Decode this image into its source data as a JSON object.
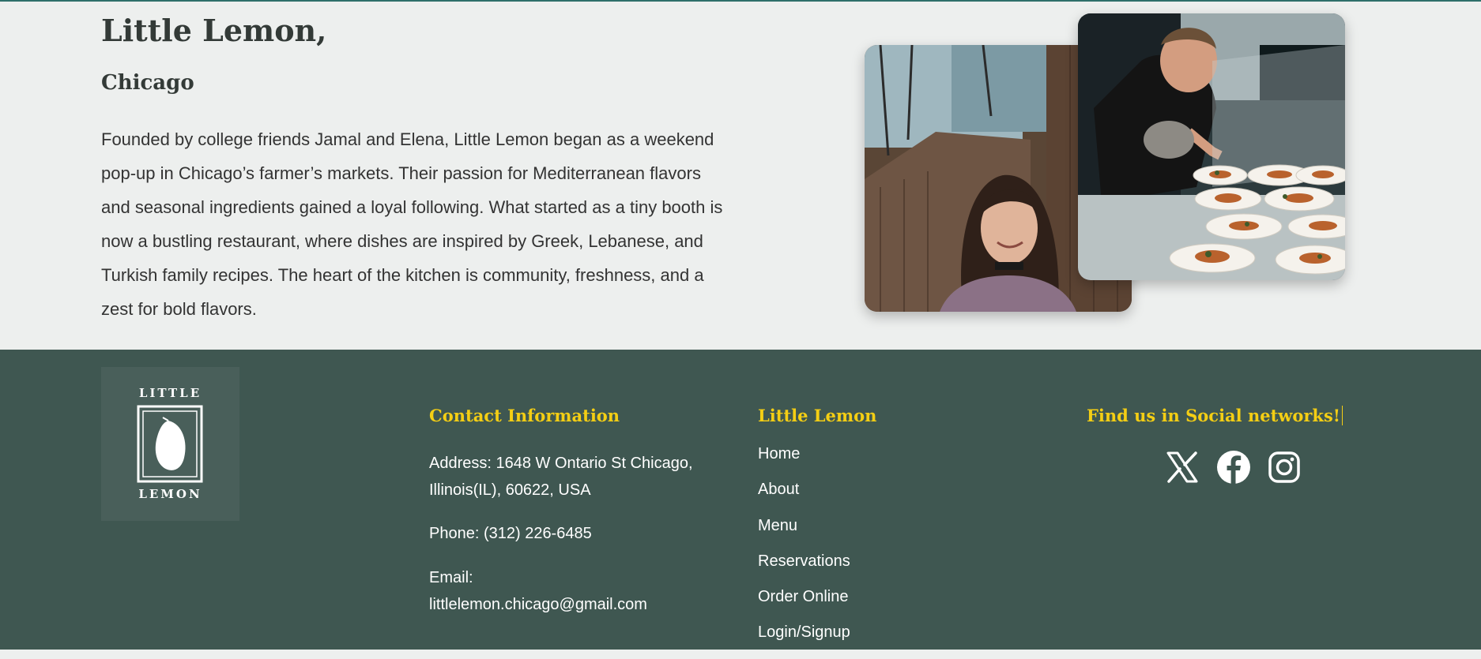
{
  "about": {
    "title": "Little Lemon,",
    "subtitle": "Chicago",
    "description": "Founded by college friends Jamal and Elena, Little Lemon began as a weekend pop-up in Chicago’s farmer’s markets. Their passion for Mediterranean flavors and seasonal ingredients gained a loyal following. What started as a tiny booth is now a bustling restaurant, where dishes are inspired by Greek, Lebanese, and Turkish family recipes. The heart of the kitchen is community, freshness, and a zest for bold flavors."
  },
  "footer": {
    "logo": {
      "top_text": "LITTLE",
      "bottom_text": "LEMON"
    },
    "contact": {
      "heading": "Contact Information",
      "address": "Address: 1648 W Ontario St Chicago, Illinois(IL), 60622, USA",
      "phone": "Phone: (312) 226-6485",
      "email_label": "Email:",
      "email": "littlelemon.chicago@gmail.com"
    },
    "nav": {
      "heading": "Little Lemon",
      "items": [
        "Home",
        "About",
        "Menu",
        "Reservations",
        "Order Online",
        "Login/Signup"
      ]
    },
    "social": {
      "heading": "Find us in Social networks!",
      "icons": [
        "x-icon",
        "facebook-icon",
        "instagram-icon"
      ]
    }
  },
  "colors": {
    "background": "#edefee",
    "footer": "#3f5751",
    "accent_yellow": "#f4ce14",
    "text_dark": "#333a37"
  }
}
